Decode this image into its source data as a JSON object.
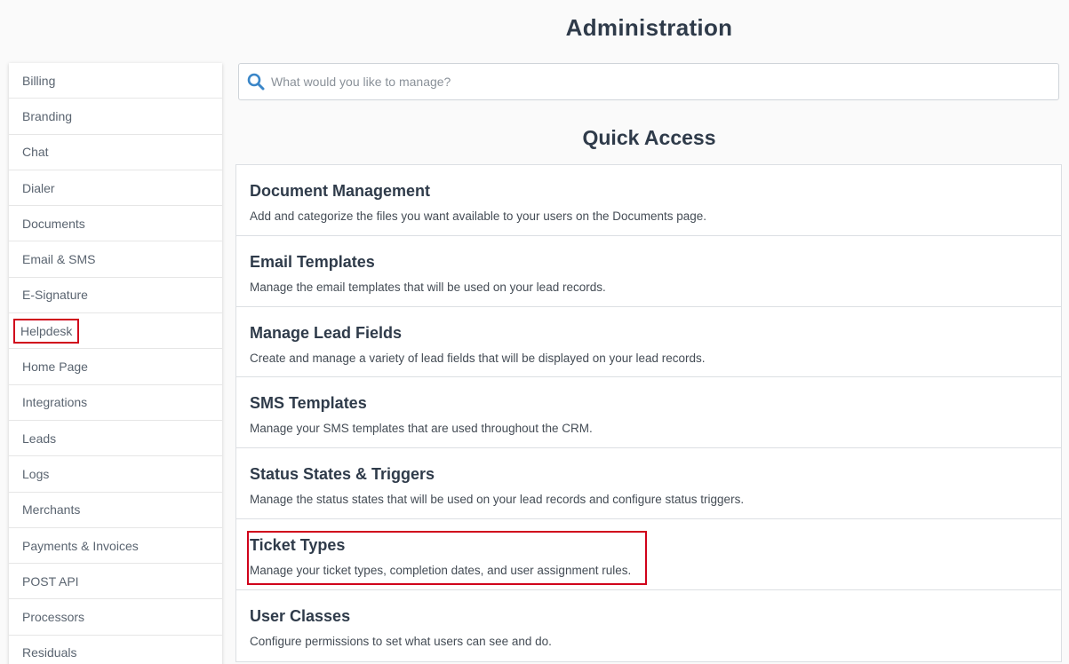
{
  "page": {
    "title": "Administration"
  },
  "search": {
    "placeholder": "What would you like to manage?"
  },
  "sidebar": {
    "items": [
      {
        "label": "Billing"
      },
      {
        "label": "Branding"
      },
      {
        "label": "Chat"
      },
      {
        "label": "Dialer"
      },
      {
        "label": "Documents"
      },
      {
        "label": "Email & SMS"
      },
      {
        "label": "E-Signature"
      },
      {
        "label": "Helpdesk",
        "highlighted": true
      },
      {
        "label": "Home Page"
      },
      {
        "label": "Integrations"
      },
      {
        "label": "Leads"
      },
      {
        "label": "Logs"
      },
      {
        "label": "Merchants"
      },
      {
        "label": "Payments & Invoices"
      },
      {
        "label": "POST API"
      },
      {
        "label": "Processors"
      },
      {
        "label": "Residuals"
      }
    ]
  },
  "quick_access": {
    "title": "Quick Access",
    "items": [
      {
        "title": "Document Management",
        "description": "Add and categorize the files you want available to your users on the Documents page."
      },
      {
        "title": "Email Templates",
        "description": "Manage the email templates that will be used on your lead records."
      },
      {
        "title": "Manage Lead Fields",
        "description": "Create and manage a variety of lead fields that will be displayed on your lead records."
      },
      {
        "title": "SMS Templates",
        "description": "Manage your SMS templates that are used throughout the CRM."
      },
      {
        "title": "Status States & Triggers",
        "description": "Manage the status states that will be used on your lead records and configure status triggers."
      },
      {
        "title": "Ticket Types",
        "description": "Manage your ticket types, completion dates, and user assignment rules.",
        "highlighted": true
      },
      {
        "title": "User Classes",
        "description": "Configure permissions to set what users can see and do."
      }
    ]
  },
  "colors": {
    "accent": "#3a86c8",
    "highlight": "#d0021b",
    "text": "#2f3b4a"
  }
}
